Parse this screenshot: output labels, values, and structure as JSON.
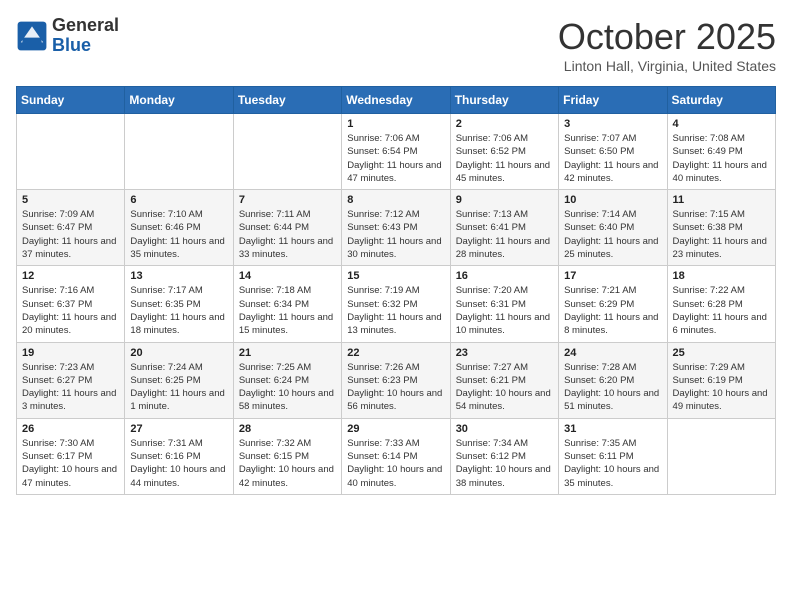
{
  "header": {
    "logo_general": "General",
    "logo_blue": "Blue",
    "month_title": "October 2025",
    "location": "Linton Hall, Virginia, United States"
  },
  "days_of_week": [
    "Sunday",
    "Monday",
    "Tuesday",
    "Wednesday",
    "Thursday",
    "Friday",
    "Saturday"
  ],
  "weeks": [
    [
      {
        "day": "",
        "info": ""
      },
      {
        "day": "",
        "info": ""
      },
      {
        "day": "",
        "info": ""
      },
      {
        "day": "1",
        "info": "Sunrise: 7:06 AM\nSunset: 6:54 PM\nDaylight: 11 hours and 47 minutes."
      },
      {
        "day": "2",
        "info": "Sunrise: 7:06 AM\nSunset: 6:52 PM\nDaylight: 11 hours and 45 minutes."
      },
      {
        "day": "3",
        "info": "Sunrise: 7:07 AM\nSunset: 6:50 PM\nDaylight: 11 hours and 42 minutes."
      },
      {
        "day": "4",
        "info": "Sunrise: 7:08 AM\nSunset: 6:49 PM\nDaylight: 11 hours and 40 minutes."
      }
    ],
    [
      {
        "day": "5",
        "info": "Sunrise: 7:09 AM\nSunset: 6:47 PM\nDaylight: 11 hours and 37 minutes."
      },
      {
        "day": "6",
        "info": "Sunrise: 7:10 AM\nSunset: 6:46 PM\nDaylight: 11 hours and 35 minutes."
      },
      {
        "day": "7",
        "info": "Sunrise: 7:11 AM\nSunset: 6:44 PM\nDaylight: 11 hours and 33 minutes."
      },
      {
        "day": "8",
        "info": "Sunrise: 7:12 AM\nSunset: 6:43 PM\nDaylight: 11 hours and 30 minutes."
      },
      {
        "day": "9",
        "info": "Sunrise: 7:13 AM\nSunset: 6:41 PM\nDaylight: 11 hours and 28 minutes."
      },
      {
        "day": "10",
        "info": "Sunrise: 7:14 AM\nSunset: 6:40 PM\nDaylight: 11 hours and 25 minutes."
      },
      {
        "day": "11",
        "info": "Sunrise: 7:15 AM\nSunset: 6:38 PM\nDaylight: 11 hours and 23 minutes."
      }
    ],
    [
      {
        "day": "12",
        "info": "Sunrise: 7:16 AM\nSunset: 6:37 PM\nDaylight: 11 hours and 20 minutes."
      },
      {
        "day": "13",
        "info": "Sunrise: 7:17 AM\nSunset: 6:35 PM\nDaylight: 11 hours and 18 minutes."
      },
      {
        "day": "14",
        "info": "Sunrise: 7:18 AM\nSunset: 6:34 PM\nDaylight: 11 hours and 15 minutes."
      },
      {
        "day": "15",
        "info": "Sunrise: 7:19 AM\nSunset: 6:32 PM\nDaylight: 11 hours and 13 minutes."
      },
      {
        "day": "16",
        "info": "Sunrise: 7:20 AM\nSunset: 6:31 PM\nDaylight: 11 hours and 10 minutes."
      },
      {
        "day": "17",
        "info": "Sunrise: 7:21 AM\nSunset: 6:29 PM\nDaylight: 11 hours and 8 minutes."
      },
      {
        "day": "18",
        "info": "Sunrise: 7:22 AM\nSunset: 6:28 PM\nDaylight: 11 hours and 6 minutes."
      }
    ],
    [
      {
        "day": "19",
        "info": "Sunrise: 7:23 AM\nSunset: 6:27 PM\nDaylight: 11 hours and 3 minutes."
      },
      {
        "day": "20",
        "info": "Sunrise: 7:24 AM\nSunset: 6:25 PM\nDaylight: 11 hours and 1 minute."
      },
      {
        "day": "21",
        "info": "Sunrise: 7:25 AM\nSunset: 6:24 PM\nDaylight: 10 hours and 58 minutes."
      },
      {
        "day": "22",
        "info": "Sunrise: 7:26 AM\nSunset: 6:23 PM\nDaylight: 10 hours and 56 minutes."
      },
      {
        "day": "23",
        "info": "Sunrise: 7:27 AM\nSunset: 6:21 PM\nDaylight: 10 hours and 54 minutes."
      },
      {
        "day": "24",
        "info": "Sunrise: 7:28 AM\nSunset: 6:20 PM\nDaylight: 10 hours and 51 minutes."
      },
      {
        "day": "25",
        "info": "Sunrise: 7:29 AM\nSunset: 6:19 PM\nDaylight: 10 hours and 49 minutes."
      }
    ],
    [
      {
        "day": "26",
        "info": "Sunrise: 7:30 AM\nSunset: 6:17 PM\nDaylight: 10 hours and 47 minutes."
      },
      {
        "day": "27",
        "info": "Sunrise: 7:31 AM\nSunset: 6:16 PM\nDaylight: 10 hours and 44 minutes."
      },
      {
        "day": "28",
        "info": "Sunrise: 7:32 AM\nSunset: 6:15 PM\nDaylight: 10 hours and 42 minutes."
      },
      {
        "day": "29",
        "info": "Sunrise: 7:33 AM\nSunset: 6:14 PM\nDaylight: 10 hours and 40 minutes."
      },
      {
        "day": "30",
        "info": "Sunrise: 7:34 AM\nSunset: 6:12 PM\nDaylight: 10 hours and 38 minutes."
      },
      {
        "day": "31",
        "info": "Sunrise: 7:35 AM\nSunset: 6:11 PM\nDaylight: 10 hours and 35 minutes."
      },
      {
        "day": "",
        "info": ""
      }
    ]
  ]
}
